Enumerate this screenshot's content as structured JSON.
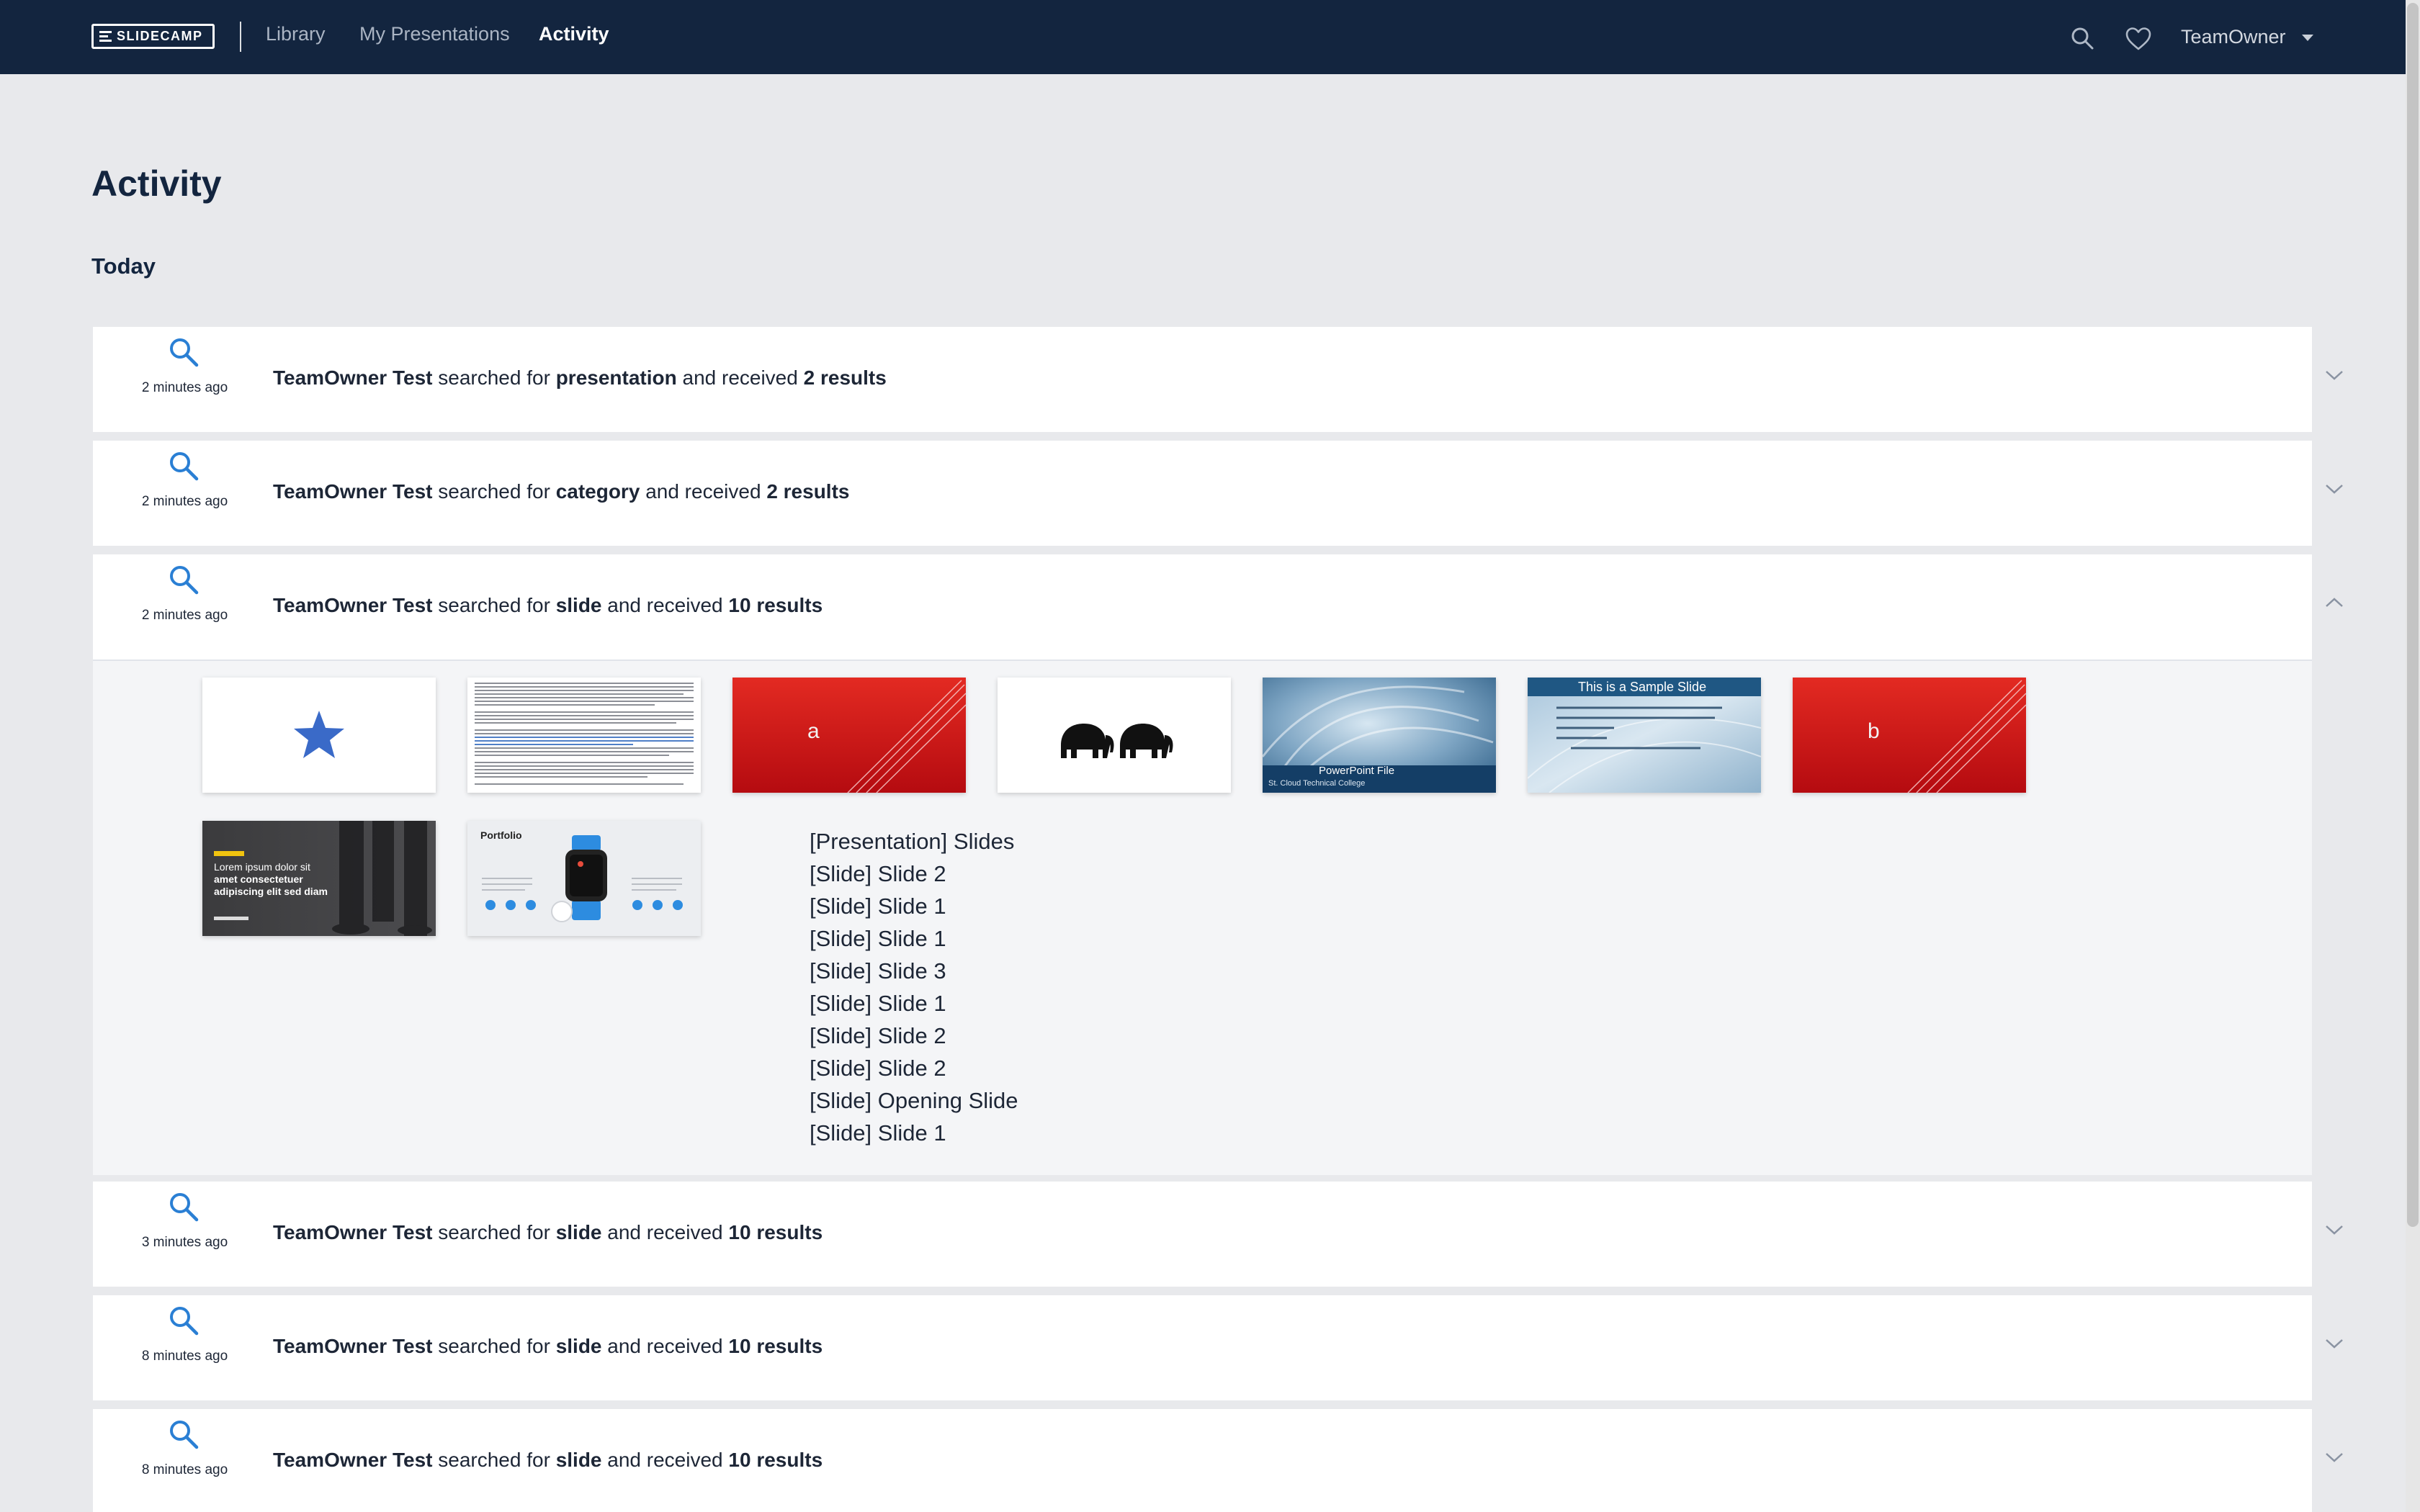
{
  "brand": {
    "name": "SLIDECAMP"
  },
  "nav": {
    "items": [
      {
        "label": "Library"
      },
      {
        "label": "My Presentations"
      },
      {
        "label": "Activity"
      }
    ],
    "user": "TeamOwner"
  },
  "page": {
    "title": "Activity",
    "section": "Today"
  },
  "activities": [
    {
      "time": "2 minutes ago",
      "user": "TeamOwner Test",
      "t1": "searched for",
      "term": "presentation",
      "t2": "and received",
      "results": "2 results",
      "expanded": false
    },
    {
      "time": "2 minutes ago",
      "user": "TeamOwner Test",
      "t1": "searched for",
      "term": "category",
      "t2": "and received",
      "results": "2 results",
      "expanded": false
    },
    {
      "time": "2 minutes ago",
      "user": "TeamOwner Test",
      "t1": "searched for",
      "term": "slide",
      "t2": "and received",
      "results": "10 results",
      "expanded": true
    },
    {
      "time": "3 minutes ago",
      "user": "TeamOwner Test",
      "t1": "searched for",
      "term": "slide",
      "t2": "and received",
      "results": "10 results",
      "expanded": false
    },
    {
      "time": "8 minutes ago",
      "user": "TeamOwner Test",
      "t1": "searched for",
      "term": "slide",
      "t2": "and received",
      "results": "10 results",
      "expanded": false
    },
    {
      "time": "8 minutes ago",
      "user": "TeamOwner Test",
      "t1": "searched for",
      "term": "slide",
      "t2": "and received",
      "results": "10 results",
      "expanded": false
    }
  ],
  "expanded_results": {
    "thumbnails": {
      "letter_a": "a",
      "letter_b": "b",
      "ppt_title": "PowerPoint File",
      "ppt_sub": "St. Cloud Technical College",
      "sample_title": "This is a Sample Slide",
      "lorem_line1": "Lorem ipsum dolor sit",
      "lorem_line2": "amet consectetuer",
      "lorem_line3": "adipiscing elit sed diam",
      "portfolio": "Portfolio"
    },
    "list": [
      "[Presentation] Slides",
      "[Slide] Slide 2",
      "[Slide] Slide 1",
      "[Slide] Slide 1",
      "[Slide] Slide 3",
      "[Slide] Slide 1",
      "[Slide] Slide 2",
      "[Slide] Slide 2",
      "[Slide] Opening Slide",
      "[Slide] Slide 1"
    ]
  },
  "colors": {
    "nav_bg": "#13253f",
    "accent": "#2a7fd4",
    "page_bg": "#e8e9ec",
    "slide_red": "#d21616"
  },
  "icons": [
    "search-icon",
    "heart-icon",
    "chevron-down-icon",
    "chevron-up-icon",
    "user-menu-caret"
  ]
}
